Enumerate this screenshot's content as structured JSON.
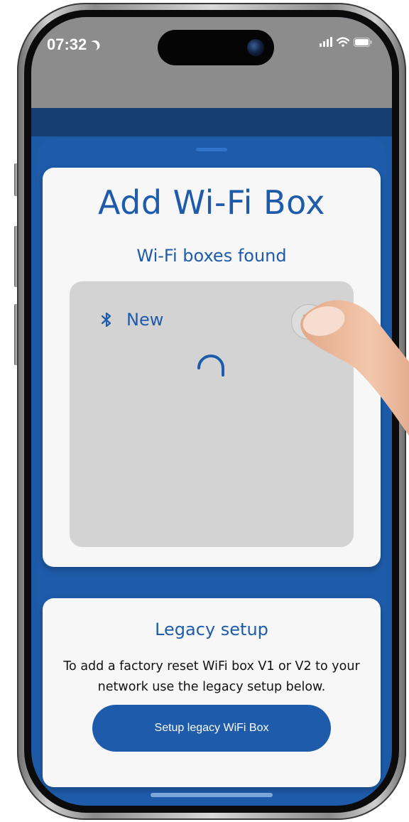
{
  "status_bar": {
    "time": "07:32"
  },
  "sheet": {
    "title": "Add Wi-Fi Box",
    "subtitle": "Wi-Fi boxes found",
    "device": {
      "name": "New",
      "icon": "bluetooth-icon",
      "settings_icon": "gear-icon"
    }
  },
  "legacy": {
    "title": "Legacy setup",
    "description": "To add a factory reset WiFi box V1 or V2 to your network use the legacy setup below.",
    "button_label": "Setup legacy WiFi Box"
  },
  "colors": {
    "accent": "#1e5cab",
    "card": "#f7f7f7",
    "panel": "#d3d3d3"
  }
}
